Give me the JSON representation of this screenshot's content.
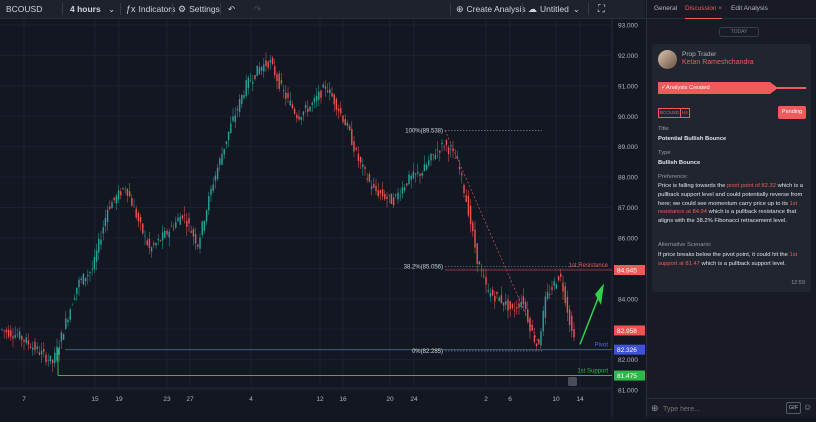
{
  "toolbar": {
    "symbol": "BCOUSD",
    "interval": "4 hours",
    "indicators_label": "Indicators",
    "settings_label": "Settings",
    "create_analysis_label": "Create Analysis",
    "untitled_label": "Untitled"
  },
  "chart_data": {
    "type": "candlestick",
    "price_range": [
      81.0,
      93.0
    ],
    "y_ticks": [
      "93.000",
      "92.000",
      "91.000",
      "90.000",
      "89.000",
      "88.000",
      "87.000",
      "86.000",
      "85.000",
      "84.000",
      "83.000",
      "82.000",
      "81.000"
    ],
    "x_ticks": [
      "7",
      "15",
      "19",
      "23",
      "27",
      "4",
      "12",
      "16",
      "20",
      "24",
      "2",
      "6",
      "10",
      "14"
    ],
    "current_price": "82.958",
    "pivot_price_label": "82.326",
    "support_price_label": "81.475",
    "resistance_price_label": "84.945",
    "pivot_label": "Pivot",
    "support_label": "1st Support",
    "resistance_label": "1st Resistance",
    "fib_100": "100%(89.538)",
    "fib_382": "38.2%(85.056)",
    "fib_0": "0%(82.285)",
    "levels": {
      "pivot": 82.326,
      "support": 81.475,
      "resistance": 84.945,
      "fib100": 89.538,
      "fib382": 85.056,
      "fib0": 82.285
    },
    "colors": {
      "up": "#26a69a",
      "down": "#ef5350",
      "pivot": "#3f51d6",
      "support": "#2fb84a",
      "resistance": "#f05a5a"
    }
  },
  "panel": {
    "tabs": [
      "General",
      "Discussion",
      "Edit Analysis"
    ],
    "tab_close": "×",
    "today": "TODAY",
    "role": "Prop Trader",
    "user_name": "Ketan Rameshchandra",
    "analysis_created": "Analysis Created",
    "tag_symbol": "BCOUSD",
    "tag_interval": "H4",
    "status": "Pending",
    "title_label": "Title",
    "title_value": "Potential Bullish Bounce",
    "type_label": "Type",
    "type_value": "Bullish Bounce",
    "preference_label": "Preference:",
    "pref_1": "Price is falling towards the ",
    "pref_2": "pivot point of 82.32",
    "pref_3": " which is a pullback support level and could potentially reverse from here; we could see momentum carry price up to its ",
    "pref_4": "1st resistance at 84.94",
    "pref_5": " which is a pullback resistance that aligns with the 38.2% Fibonacci retracement level.",
    "alt_label": "Alternative Scenario:",
    "alt_1": "If price breaks below the pivot point, it could hit the ",
    "alt_2": "1st support at 81.47",
    "alt_3": " which is a pullback support level.",
    "time": "12:59",
    "input_placeholder": "Type here...",
    "gif_label": "GIF"
  }
}
